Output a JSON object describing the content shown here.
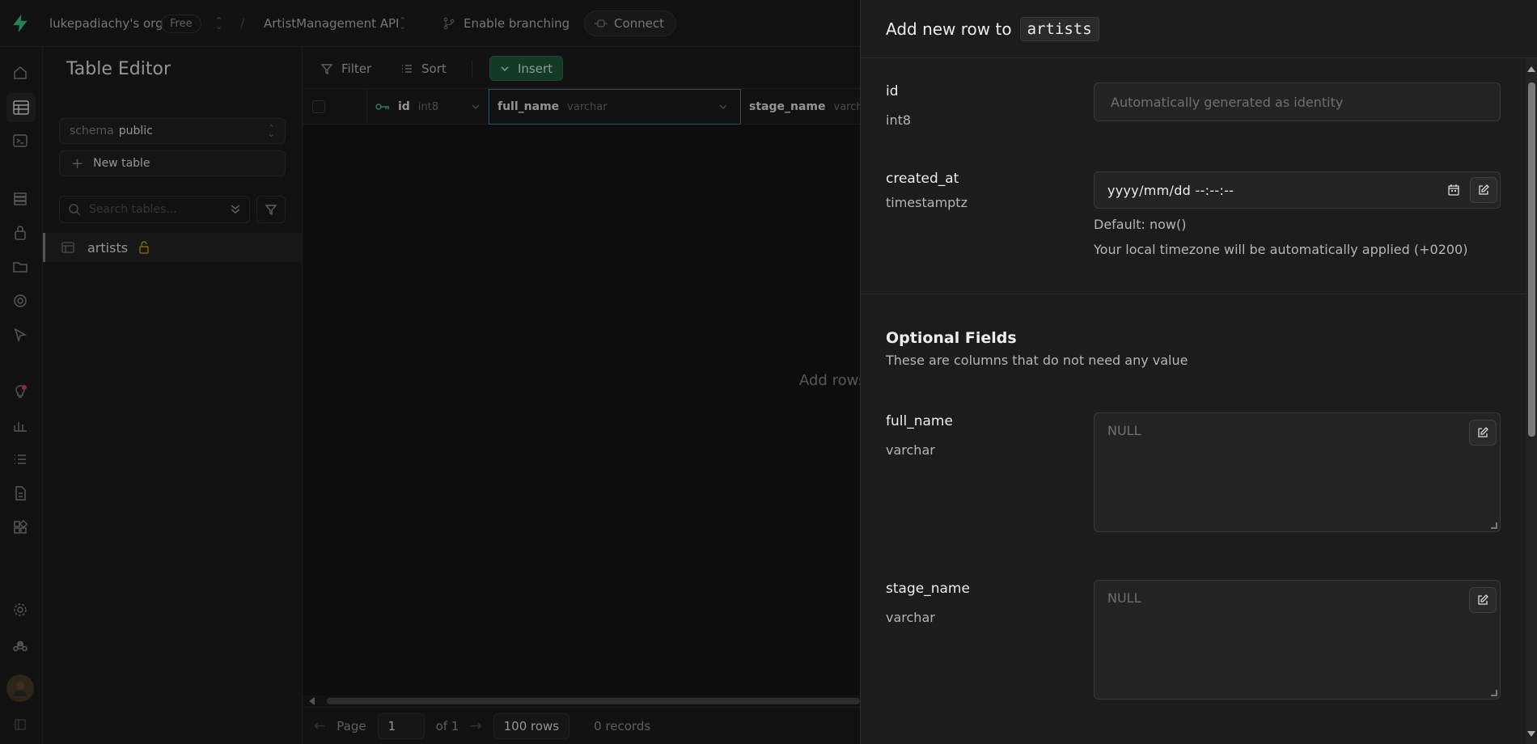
{
  "topbar": {
    "org": "lukepadiachy's org",
    "plan": "Free",
    "separator": "/",
    "project": "ArtistManagement API",
    "branching": "Enable branching",
    "connect": "Connect"
  },
  "sidebar": {
    "title": "Table Editor",
    "schema_label": "schema",
    "schema_value": "public",
    "new_table": "New table",
    "search_placeholder": "Search tables...",
    "tables": [
      {
        "name": "artists"
      }
    ]
  },
  "grid": {
    "filter": "Filter",
    "sort": "Sort",
    "insert": "Insert",
    "columns": [
      {
        "name": "id",
        "type": "int8"
      },
      {
        "name": "full_name",
        "type": "varchar"
      },
      {
        "name": "stage_name",
        "type": "varchar"
      }
    ],
    "empty_text": "Add rows",
    "footer": {
      "page_label": "Page",
      "page_value": "1",
      "of": "of 1",
      "rows": "100 rows",
      "records": "0 records"
    }
  },
  "panel": {
    "title": "Add new row to",
    "table": "artists",
    "fields": {
      "id": {
        "name": "id",
        "type": "int8",
        "placeholder": "Automatically generated as identity"
      },
      "created_at": {
        "name": "created_at",
        "type": "timestamptz",
        "value": "yyyy/mm/dd --:--:--",
        "default": "Default: now()",
        "tz_note": "Your local timezone will be automatically applied (+0200)"
      }
    },
    "optional": {
      "title": "Optional Fields",
      "subtitle": "These are columns that do not need any value",
      "fields": [
        {
          "name": "full_name",
          "type": "varchar",
          "placeholder": "NULL"
        },
        {
          "name": "stage_name",
          "type": "varchar",
          "placeholder": "NULL"
        }
      ]
    }
  },
  "colors": {
    "bg": "#1c1c1c",
    "brand_green": "#3ecf8e",
    "insert_green": "#1d5e3a",
    "lock_orange": "#d4a017",
    "notification_red": "#e5484d"
  }
}
